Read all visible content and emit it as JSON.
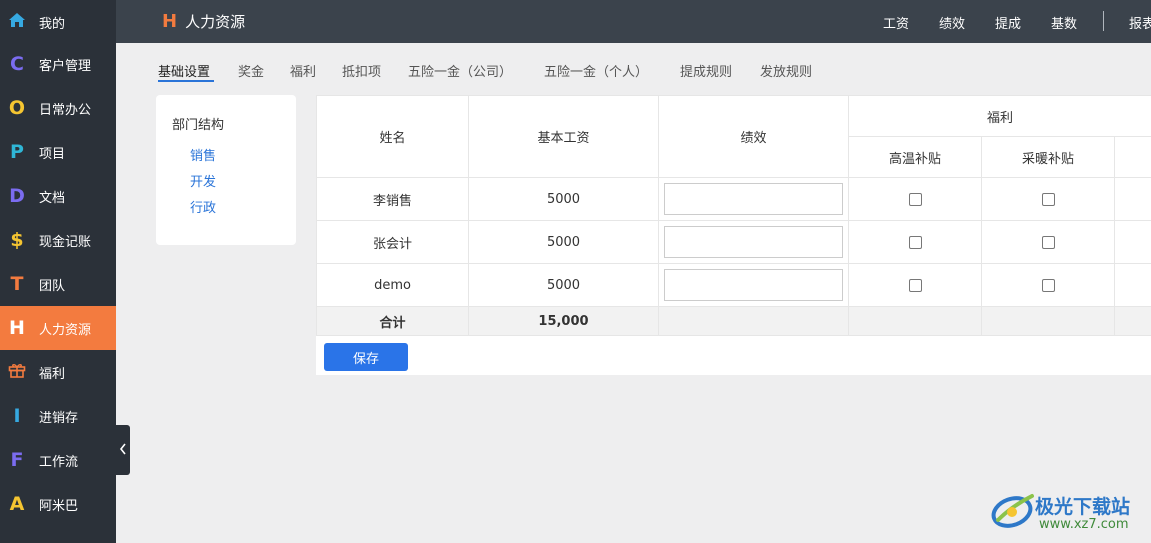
{
  "sidebar": {
    "items": [
      {
        "icon": "home-icon",
        "glyph": "⌂",
        "color": "#36a9e1",
        "label": "我的"
      },
      {
        "icon": "c-letter-icon",
        "glyph": "C",
        "color": "#7b6cf0",
        "label": "客户管理"
      },
      {
        "icon": "o-letter-icon",
        "glyph": "O",
        "color": "#f5c531",
        "label": "日常办公"
      },
      {
        "icon": "p-letter-icon",
        "glyph": "P",
        "color": "#2fb6d6",
        "label": "项目"
      },
      {
        "icon": "d-letter-icon",
        "glyph": "D",
        "color": "#7b6cf0",
        "label": "文档"
      },
      {
        "icon": "dollar-icon",
        "glyph": "$",
        "color": "#f5c531",
        "label": "现金记账"
      },
      {
        "icon": "t-letter-icon",
        "glyph": "T",
        "color": "#f37b3f",
        "label": "团队"
      },
      {
        "icon": "h-letter-icon",
        "glyph": "H",
        "color": "#ffffff",
        "label": "人力资源",
        "active": true
      },
      {
        "icon": "gift-icon",
        "glyph": "🎁",
        "color": "#f37b3f",
        "label": "福利"
      },
      {
        "icon": "i-letter-icon",
        "glyph": "I",
        "color": "#36a9e1",
        "label": "进销存"
      },
      {
        "icon": "f-letter-icon",
        "glyph": "F",
        "color": "#7b6cf0",
        "label": "工作流"
      },
      {
        "icon": "a-letter-icon",
        "glyph": "A",
        "color": "#f5c531",
        "label": "阿米巴"
      }
    ]
  },
  "header": {
    "brand_mark": "H",
    "title": "人力资源",
    "nav": [
      "工资",
      "绩效",
      "提成",
      "基数",
      "报表"
    ]
  },
  "tabs": [
    "基础设置",
    "奖金",
    "福利",
    "抵扣项",
    "五险一金（公司）",
    "五险一金（个人）",
    "提成规则",
    "发放规则"
  ],
  "active_tab": "基础设置",
  "departments": {
    "title": "部门结构",
    "items": [
      "销售",
      "开发",
      "行政"
    ]
  },
  "table": {
    "headers": {
      "name": "姓名",
      "base_salary": "基本工资",
      "performance": "绩效",
      "benefits_group": "福利",
      "benefit_1": "高温补贴",
      "benefit_2": "采暖补贴"
    },
    "rows": [
      {
        "name": "李销售",
        "base_salary": "5000"
      },
      {
        "name": "张会计",
        "base_salary": "5000"
      },
      {
        "name": "demo",
        "base_salary": "5000"
      }
    ],
    "total_label": "合计",
    "total_base_salary": "15,000"
  },
  "save_label": "保存",
  "watermark": {
    "text": "极光下载站",
    "url": "www.xz7.com"
  }
}
